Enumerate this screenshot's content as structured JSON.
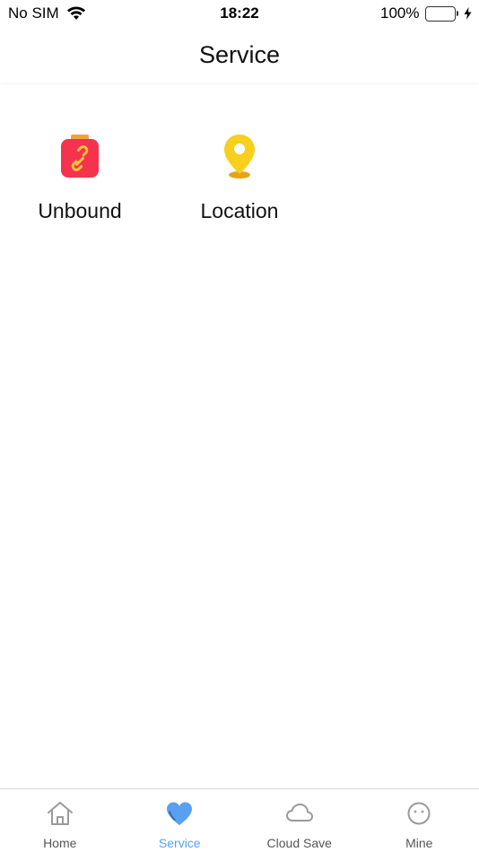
{
  "status_bar": {
    "carrier": "No SIM",
    "time": "18:22",
    "battery": "100%",
    "battery_level": 1.0
  },
  "nav": {
    "title": "Service"
  },
  "services": [
    {
      "label": "Unbound",
      "icon": "link-badge-icon",
      "color": "#f5334f"
    },
    {
      "label": "Location",
      "icon": "map-pin-icon",
      "color": "#f7cf1d"
    }
  ],
  "tabs": [
    {
      "label": "Home",
      "icon": "home-icon",
      "active": false
    },
    {
      "label": "Service",
      "icon": "heart-icon",
      "active": true
    },
    {
      "label": "Cloud Save",
      "icon": "cloud-icon",
      "active": false
    },
    {
      "label": "Mine",
      "icon": "face-icon",
      "active": false
    }
  ],
  "colors": {
    "active_tab": "#5aa0f0",
    "inactive_tab": "#555555",
    "battery_fill": "#4cd964"
  }
}
